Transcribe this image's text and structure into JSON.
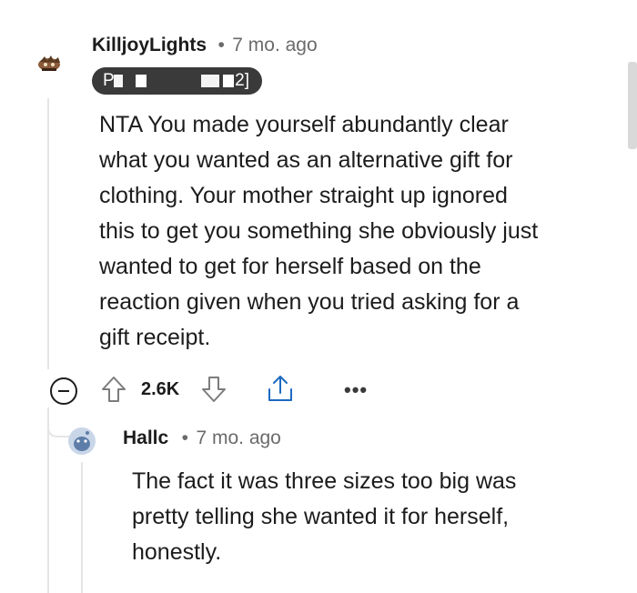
{
  "comment": {
    "username": "KilljoyLights",
    "time": "7 mo. ago",
    "flair": {
      "visible_start": "P",
      "visible_end": "2]"
    },
    "body_lines": [
      "NTA You made yourself abundantly clear",
      "what you wanted as an alternative gift for",
      "clothing. Your mother straight up ignored",
      "this to get you something she obviously just",
      "wanted to get for herself based on the",
      "reaction given when you tried asking for a",
      "gift receipt."
    ],
    "score": "2.6K",
    "more_label": "•••"
  },
  "reply": {
    "username": "Hallc",
    "time": "7 mo. ago",
    "body_lines": [
      "The fact it was three sizes too big was",
      "pretty telling she wanted it for herself,",
      "honestly."
    ]
  },
  "separator": "•",
  "colors": {
    "meta": "#6b6b6b",
    "text": "#1c1c1c",
    "avatar_blue": "#7a9cc6"
  }
}
